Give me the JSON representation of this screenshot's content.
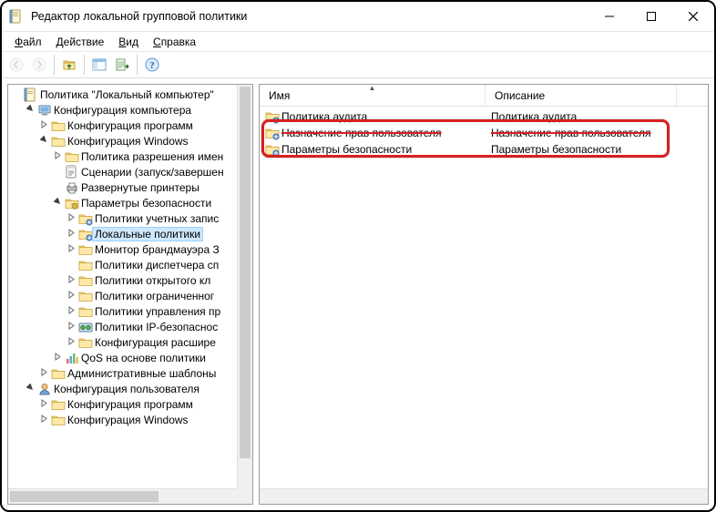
{
  "title": "Редактор локальной групповой политики",
  "menus": {
    "file": "Файл",
    "action": "Действие",
    "view": "Вид",
    "help": "Справка"
  },
  "tree": [
    {
      "indent": 0,
      "toggle": "",
      "icon": "root",
      "label": "Политика \"Локальный компьютер\""
    },
    {
      "indent": 1,
      "toggle": "open",
      "icon": "computer",
      "label": "Конфигурация компьютера"
    },
    {
      "indent": 2,
      "toggle": "closed",
      "icon": "folder",
      "label": "Конфигурация программ"
    },
    {
      "indent": 2,
      "toggle": "open",
      "icon": "folder",
      "label": "Конфигурация Windows"
    },
    {
      "indent": 3,
      "toggle": "closed",
      "icon": "folder",
      "label": "Политика разрешения имен"
    },
    {
      "indent": 3,
      "toggle": "",
      "icon": "script",
      "label": "Сценарии (запуск/завершен"
    },
    {
      "indent": 3,
      "toggle": "",
      "icon": "printer",
      "label": "Развернутые принтеры"
    },
    {
      "indent": 3,
      "toggle": "open",
      "icon": "security",
      "label": "Параметры безопасности"
    },
    {
      "indent": 4,
      "toggle": "closed",
      "icon": "folder-b",
      "label": "Политики учетных запис"
    },
    {
      "indent": 4,
      "toggle": "closed",
      "icon": "folder-b",
      "label": "Локальные политики",
      "selected": true
    },
    {
      "indent": 4,
      "toggle": "closed",
      "icon": "folder",
      "label": "Монитор брандмауэра З"
    },
    {
      "indent": 4,
      "toggle": "",
      "icon": "folder",
      "label": "Политики диспетчера сп"
    },
    {
      "indent": 4,
      "toggle": "closed",
      "icon": "folder",
      "label": "Политики открытого кл"
    },
    {
      "indent": 4,
      "toggle": "closed",
      "icon": "folder",
      "label": "Политики ограниченног"
    },
    {
      "indent": 4,
      "toggle": "closed",
      "icon": "folder",
      "label": "Политики управления пр"
    },
    {
      "indent": 4,
      "toggle": "closed",
      "icon": "ipsec",
      "label": "Политики IP-безопаснос"
    },
    {
      "indent": 4,
      "toggle": "closed",
      "icon": "folder",
      "label": "Конфигурация расшире"
    },
    {
      "indent": 3,
      "toggle": "closed",
      "icon": "qos",
      "label": "QoS на основе политики"
    },
    {
      "indent": 2,
      "toggle": "closed",
      "icon": "folder",
      "label": "Административные шаблоны"
    },
    {
      "indent": 1,
      "toggle": "open",
      "icon": "user",
      "label": "Конфигурация пользователя"
    },
    {
      "indent": 2,
      "toggle": "closed",
      "icon": "folder",
      "label": "Конфигурация программ"
    },
    {
      "indent": 2,
      "toggle": "closed",
      "icon": "folder",
      "label": "Конфигурация Windows"
    }
  ],
  "list": {
    "columns": {
      "name": "Имя",
      "desc": "Описание"
    },
    "col_widths": {
      "name": 248,
      "desc": 210
    },
    "rows": [
      {
        "name": "Политика аудита",
        "desc": "Политика аудита",
        "strike": false
      },
      {
        "name": "Назначение прав пользователя",
        "desc": "Назначение прав пользователя",
        "strike": true
      },
      {
        "name": "Параметры безопасности",
        "desc": "Параметры безопасности",
        "strike": false
      }
    ]
  },
  "highlight_row_index": 2
}
